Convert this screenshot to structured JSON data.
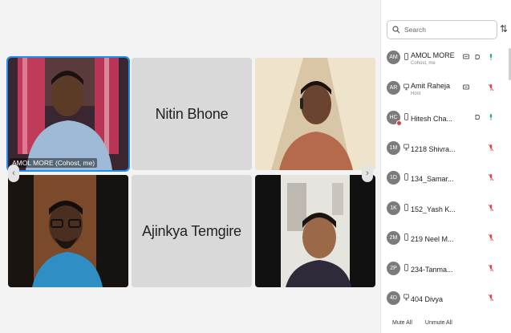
{
  "colors": {
    "accent": "#1f8ef1",
    "mic_muted": "#e0463b",
    "mic_active": "#2bb673",
    "avatar": "#7b7b7b",
    "tile_bg": "#d9d9d9"
  },
  "video_grid": {
    "tiles": [
      {
        "caption": "AMOL MORE (Cohost, me)",
        "has_video": true,
        "active_speaker": true
      },
      {
        "name": "Nitin Bhone",
        "has_video": false
      },
      {
        "has_video": true
      },
      {
        "has_video": true
      },
      {
        "name": "Ajinkya Temgire",
        "has_video": false
      },
      {
        "has_video": true
      }
    ],
    "prev_icon": "chevron-left-icon",
    "next_icon": "chevron-right-icon"
  },
  "participants_panel": {
    "search": {
      "placeholder": "Search",
      "value": ""
    },
    "sort_icon": "sort-icon",
    "participants": [
      {
        "initials": "AM",
        "name": "AMOL MORE",
        "role": "Cohost, me",
        "device": "phone-icon",
        "chat_icon": true,
        "camera_icon": true,
        "mic": "active"
      },
      {
        "initials": "AR",
        "name": "Amit Raheja",
        "role": "Host",
        "device": "desktop-icon",
        "chat_icon": true,
        "camera_icon": false,
        "mic": "muted"
      },
      {
        "initials": "HC",
        "name": "Hitesh Cha...",
        "role": "",
        "device": "phone-icon",
        "chat_icon": false,
        "camera_icon": true,
        "mic": "active",
        "badge": true
      },
      {
        "initials": "1M",
        "name": "1218 Shivra...",
        "role": "",
        "device": "desktop-icon",
        "mic": "muted"
      },
      {
        "initials": "1D",
        "name": "134_Samar...",
        "role": "",
        "device": "phone-icon",
        "mic": "muted"
      },
      {
        "initials": "1K",
        "name": "152_Yash K...",
        "role": "",
        "device": "phone-icon",
        "mic": "muted"
      },
      {
        "initials": "2M",
        "name": "219 Neel M...",
        "role": "",
        "device": "phone-icon",
        "mic": "muted"
      },
      {
        "initials": "2P",
        "name": "234-Tanma...",
        "role": "",
        "device": "phone-icon",
        "mic": "muted"
      },
      {
        "initials": "4D",
        "name": "404 Divya",
        "role": "",
        "device": "desktop-icon",
        "mic": "muted"
      }
    ],
    "footer": {
      "mute_all": "Mute All",
      "unmute_all": "Unmute All"
    }
  }
}
